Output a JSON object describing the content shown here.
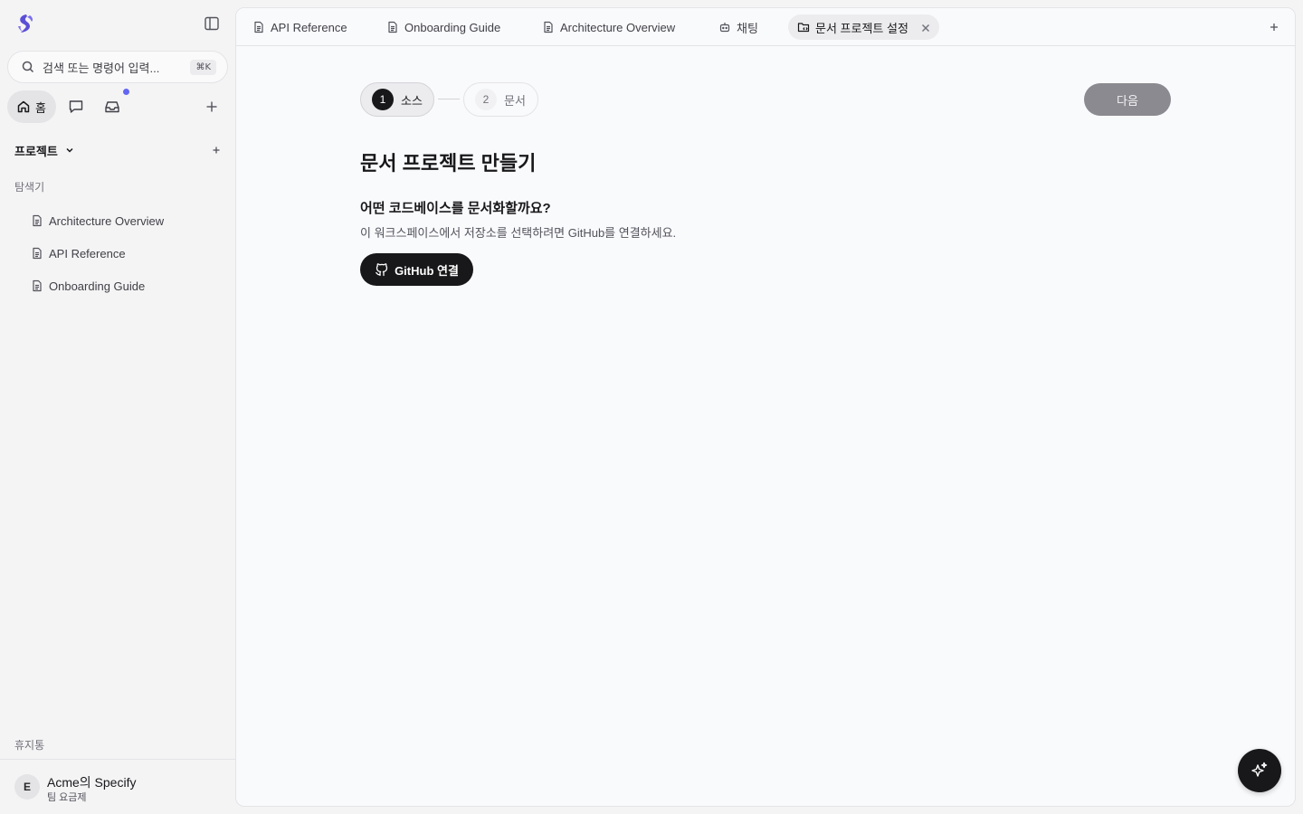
{
  "sidebar": {
    "search_placeholder": "검색 또는 명령어 입력...",
    "search_shortcut": "⌘K",
    "home_label": "홈",
    "projects_label": "프로젝트",
    "explorer_label": "탐색기",
    "items": [
      {
        "label": "Architecture Overview",
        "icon": "document-icon"
      },
      {
        "label": "API Reference",
        "icon": "document-icon"
      },
      {
        "label": "Onboarding Guide",
        "icon": "document-icon"
      }
    ],
    "trash_label": "휴지통",
    "account": {
      "initial": "E",
      "name": "Acme의 Specify",
      "plan": "팀 요금제"
    }
  },
  "tabs": [
    {
      "label": "API Reference",
      "icon": "document-icon"
    },
    {
      "label": "Onboarding Guide",
      "icon": "document-icon"
    },
    {
      "label": "Architecture Overview",
      "icon": "document-icon"
    },
    {
      "label": "채팅",
      "icon": "bot-icon"
    },
    {
      "label": "문서 프로젝트 설정",
      "icon": "folder-code-icon",
      "active": true
    }
  ],
  "wizard": {
    "steps": [
      {
        "num": "1",
        "label": "소스",
        "active": true
      },
      {
        "num": "2",
        "label": "문서",
        "active": false
      }
    ],
    "next_label": "다음",
    "title": "문서 프로젝트 만들기",
    "question": "어떤 코드베이스를 문서화할까요?",
    "description": "이 워크스페이스에서 저장소를 선택하려면 GitHub를 연결하세요.",
    "github_button": "GitHub 연결"
  },
  "colors": {
    "accent_dot": "#6366f1",
    "logo": "#5b4fd6",
    "primary_button": "#18181b",
    "disabled_button": "#8a8a90"
  }
}
